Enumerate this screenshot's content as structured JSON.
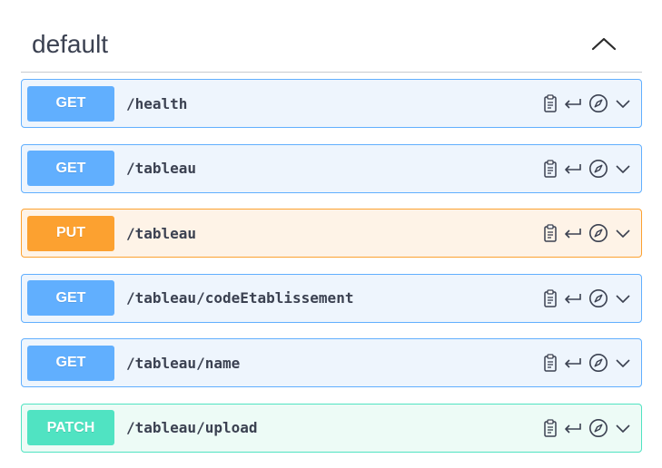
{
  "section": {
    "title": "default",
    "toggle_icon": "chevron-up-icon"
  },
  "operations": [
    {
      "method": "GET",
      "path": "/health"
    },
    {
      "method": "GET",
      "path": "/tableau"
    },
    {
      "method": "PUT",
      "path": "/tableau"
    },
    {
      "method": "GET",
      "path": "/tableau/codeEtablissement"
    },
    {
      "method": "GET",
      "path": "/tableau/name"
    },
    {
      "method": "PATCH",
      "path": "/tableau/upload"
    }
  ],
  "row_icons": [
    "clipboard-icon",
    "return-arrow-icon",
    "compass-icon",
    "chevron-down-icon"
  ],
  "colors": {
    "get": "#61affe",
    "put": "#fca130",
    "patch": "#50e3c2",
    "text": "#3b4151"
  }
}
